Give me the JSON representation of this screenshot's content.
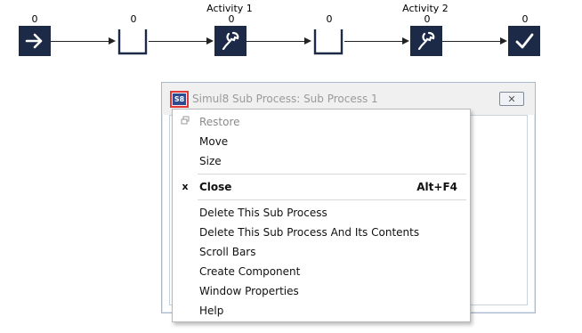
{
  "flow": {
    "counts": [
      "0",
      "0",
      "0",
      "0",
      "0",
      "0"
    ],
    "activity_labels": [
      "Activity 1",
      "Activity 2"
    ]
  },
  "subwindow": {
    "icon_text": "S8",
    "title": "Simul8 Sub Process: Sub Process 1",
    "close_glyph": "✕"
  },
  "menu": {
    "items": [
      {
        "label": "Restore",
        "icon": "restore-icon",
        "disabled": true
      },
      {
        "label": "Move"
      },
      {
        "label": "Size"
      },
      {
        "label": "Close",
        "icon": "x",
        "shortcut": "Alt+F4",
        "bold": true
      },
      {
        "label": "Delete This Sub Process"
      },
      {
        "label": "Delete This Sub Process And Its Contents"
      },
      {
        "label": "Scroll Bars"
      },
      {
        "label": "Create Component"
      },
      {
        "label": "Window Properties"
      },
      {
        "label": "Help"
      }
    ]
  },
  "colors": {
    "node_fill": "#1c2a48",
    "highlight": "#e53935"
  }
}
